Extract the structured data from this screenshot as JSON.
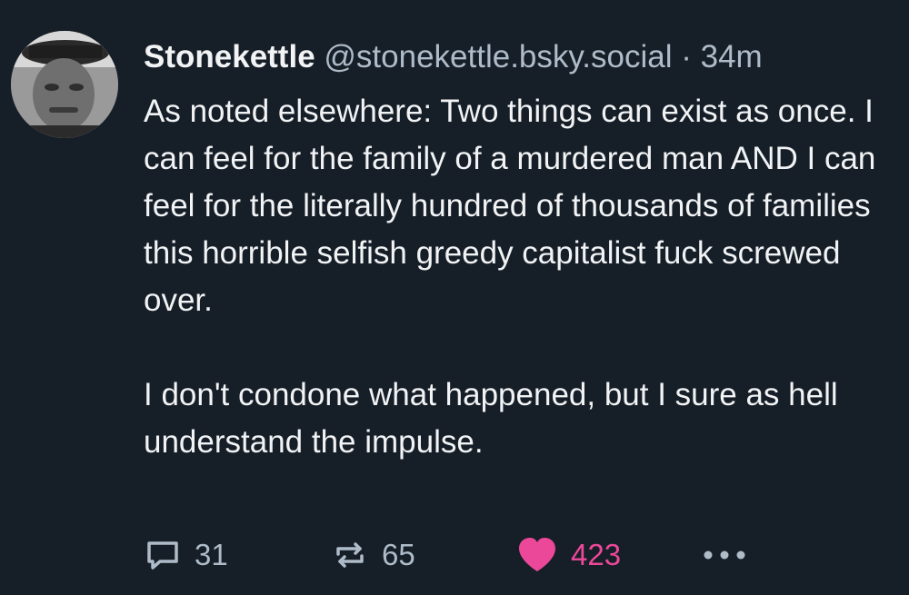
{
  "post": {
    "author": {
      "display_name": "Stonekettle",
      "handle": "@stonekettle.bsky.social",
      "separator": "·",
      "time": "34m"
    },
    "paragraphs": [
      "As noted elsewhere: Two things can exist as once. I can feel for the family of a murdered man AND I can feel for the literally hundred of thousands of families this horrible selfish greedy capitalist fuck screwed over.",
      "I don't condone what happened, but I sure as hell understand the impulse."
    ],
    "actions": {
      "reply_count": "31",
      "repost_count": "65",
      "like_count": "423"
    }
  },
  "icons": {
    "reply": "speech-bubble-icon",
    "repost": "repost-arrows-icon",
    "like": "heart-icon",
    "more": "ellipsis-icon",
    "avatar": "avatar-photo"
  },
  "colors": {
    "background": "#161e27",
    "text": "#f1f3f5",
    "muted": "#aebbc9",
    "like_accent": "#ec4899"
  }
}
